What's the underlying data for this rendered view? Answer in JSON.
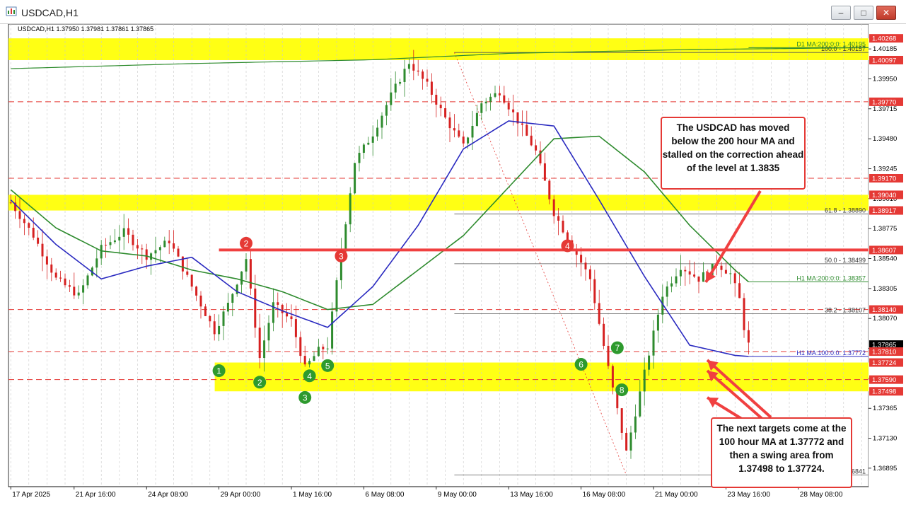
{
  "window": {
    "title": "USDCAD,H1",
    "min_glyph": "–",
    "max_glyph": "□",
    "close_glyph": "✕",
    "app_icon": "chart-window-icon"
  },
  "info_line": "USDCAD,H1  1.37950 1.37981 1.37861 1.37865",
  "callouts": [
    "The USDCAD has moved below the 200 hour MA and stalled on the correction ahead of the level at 1.3835",
    "The next targets come at the 100 hour MA at 1.37772 and then a swing area from 1.37498 to 1.37724."
  ],
  "chart_data": {
    "type": "candlestick",
    "symbol": "USDCAD",
    "timeframe": "H1",
    "ylim": [
      1.3675,
      1.4038
    ],
    "price_axis_ticks": [
      "1.40185",
      "1.39950",
      "1.39715",
      "1.39480",
      "1.39245",
      "1.39010",
      "1.38775",
      "1.38540",
      "1.38305",
      "1.38070",
      "1.37835",
      "1.37600",
      "1.37365",
      "1.37130",
      "1.36895"
    ],
    "price_ticks_values": [
      1.40185,
      1.3995,
      1.39715,
      1.3948,
      1.39245,
      1.3901,
      1.38775,
      1.3854,
      1.38305,
      1.3807,
      1.37835,
      1.376,
      1.37365,
      1.3713,
      1.36895
    ],
    "time_labels": [
      "17 Apr 2025",
      "21 Apr 16:00",
      "24 Apr 08:00",
      "29 Apr 00:00",
      "1 May 16:00",
      "6 May 08:00",
      "9 May 00:00",
      "13 May 16:00",
      "16 May 08:00",
      "21 May 00:00",
      "23 May 16:00",
      "28 May 08:00"
    ],
    "time_label_index": [
      0,
      14,
      30,
      46,
      62,
      78,
      94,
      110,
      126,
      142,
      158,
      174
    ],
    "num_bars": 190,
    "price_labels": [
      {
        "text": "1.40268",
        "value": 1.40268,
        "color": "#e53935"
      },
      {
        "text": "1.40097",
        "value": 1.40097,
        "color": "#e53935"
      },
      {
        "text": "1.39770",
        "value": 1.3977,
        "color": "#e53935"
      },
      {
        "text": "1.39170",
        "value": 1.3917,
        "color": "#e53935"
      },
      {
        "text": "1.39040",
        "value": 1.3904,
        "color": "#e53935"
      },
      {
        "text": "1.38917",
        "value": 1.38917,
        "color": "#e53935"
      },
      {
        "text": "1.38607",
        "value": 1.38607,
        "color": "#e53935"
      },
      {
        "text": "1.38140",
        "value": 1.3814,
        "color": "#e53935"
      },
      {
        "text": "1.37865",
        "value": 1.37865,
        "color": "#000000"
      },
      {
        "text": "1.37810",
        "value": 1.3781,
        "color": "#e53935"
      },
      {
        "text": "1.37724",
        "value": 1.37724,
        "color": "#e53935"
      },
      {
        "text": "1.37590",
        "value": 1.3759,
        "color": "#e53935"
      },
      {
        "text": "1.37498",
        "value": 1.37498,
        "color": "#e53935"
      }
    ],
    "yellow_zones": [
      {
        "from": 1.40097,
        "to": 1.40268
      },
      {
        "from": 1.38917,
        "to": 1.3904
      },
      {
        "from": 1.37498,
        "to": 1.37724
      }
    ],
    "dashed_levels": [
      1.3977,
      1.3917,
      1.3814,
      1.3781,
      1.3759
    ],
    "fib_levels": [
      {
        "label": "100.0 - 1.40157",
        "value": 1.40157
      },
      {
        "label": "61.8 - 1.38890",
        "value": 1.3889
      },
      {
        "label": "50.0 - 1.38499",
        "value": 1.38499
      },
      {
        "label": "38.2 - 1.38107",
        "value": 1.38107
      },
      {
        "label": "6841",
        "value": 1.36841
      }
    ],
    "ma_labels": [
      {
        "label": "D1 MA:200:0:0: 1.40195",
        "value": 1.40195,
        "color": "#2e8b2e"
      },
      {
        "label": "H1 MA:200:0:0: 1.38357",
        "value": 1.38357,
        "color": "#2e8b2e"
      },
      {
        "label": "H1 MA:100:0:0: 1.37772",
        "value": 1.37772,
        "color": "#2a2ac0"
      }
    ],
    "resistance_line": {
      "value": 1.38607,
      "from_index": 46
    },
    "markers": [
      {
        "label": "1",
        "index": 46,
        "value": 1.3766,
        "color": "#2e9a2e"
      },
      {
        "label": "2",
        "index": 55,
        "value": 1.3757,
        "color": "#2e9a2e"
      },
      {
        "label": "3",
        "index": 65,
        "value": 1.3745,
        "color": "#2e9a2e"
      },
      {
        "label": "4",
        "index": 66,
        "value": 1.3762,
        "color": "#2e9a2e"
      },
      {
        "label": "5",
        "index": 70,
        "value": 1.377,
        "color": "#2e9a2e"
      },
      {
        "label": "6",
        "index": 126,
        "value": 1.3771,
        "color": "#2e9a2e"
      },
      {
        "label": "7",
        "index": 134,
        "value": 1.3784,
        "color": "#2e9a2e"
      },
      {
        "label": "8",
        "index": 135,
        "value": 1.3751,
        "color": "#2e9a2e"
      },
      {
        "label": "2",
        "index": 52,
        "value": 1.3866,
        "color": "#e53935"
      },
      {
        "label": "3",
        "index": 73,
        "value": 1.3856,
        "color": "#e53935"
      },
      {
        "label": "4",
        "index": 123,
        "value": 1.3864,
        "color": "#e53935"
      }
    ],
    "close_path": [
      [
        0,
        1.3898
      ],
      [
        5,
        1.3872
      ],
      [
        10,
        1.3838
      ],
      [
        15,
        1.3825
      ],
      [
        20,
        1.3862
      ],
      [
        25,
        1.3875
      ],
      [
        30,
        1.3856
      ],
      [
        35,
        1.3868
      ],
      [
        40,
        1.3832
      ],
      [
        45,
        1.3797
      ],
      [
        48,
        1.3818
      ],
      [
        52,
        1.3854
      ],
      [
        55,
        1.3776
      ],
      [
        58,
        1.3818
      ],
      [
        62,
        1.3805
      ],
      [
        65,
        1.3768
      ],
      [
        68,
        1.3782
      ],
      [
        70,
        1.3785
      ],
      [
        73,
        1.386
      ],
      [
        76,
        1.393
      ],
      [
        80,
        1.3952
      ],
      [
        84,
        1.3982
      ],
      [
        88,
        1.4008
      ],
      [
        92,
        1.399
      ],
      [
        96,
        1.3964
      ],
      [
        100,
        1.3942
      ],
      [
        104,
        1.3976
      ],
      [
        108,
        1.3985
      ],
      [
        112,
        1.3962
      ],
      [
        116,
        1.3938
      ],
      [
        120,
        1.389
      ],
      [
        124,
        1.3864
      ],
      [
        128,
        1.3838
      ],
      [
        132,
        1.3768
      ],
      [
        136,
        1.3702
      ],
      [
        140,
        1.3764
      ],
      [
        144,
        1.3826
      ],
      [
        148,
        1.3848
      ],
      [
        152,
        1.3838
      ],
      [
        156,
        1.385
      ],
      [
        159,
        1.3842
      ],
      [
        161,
        1.3822
      ],
      [
        162,
        1.38
      ],
      [
        163,
        1.37865
      ]
    ],
    "ma200_h1": [
      [
        0,
        1.3908
      ],
      [
        10,
        1.3878
      ],
      [
        20,
        1.386
      ],
      [
        30,
        1.3856
      ],
      [
        40,
        1.3845
      ],
      [
        50,
        1.3838
      ],
      [
        60,
        1.3828
      ],
      [
        70,
        1.3814
      ],
      [
        80,
        1.3818
      ],
      [
        90,
        1.3845
      ],
      [
        100,
        1.3872
      ],
      [
        110,
        1.391
      ],
      [
        120,
        1.3948
      ],
      [
        130,
        1.395
      ],
      [
        140,
        1.3922
      ],
      [
        150,
        1.388
      ],
      [
        160,
        1.3845
      ],
      [
        163,
        1.38357
      ]
    ],
    "ma100_h1": [
      [
        0,
        1.39
      ],
      [
        10,
        1.3865
      ],
      [
        20,
        1.3838
      ],
      [
        30,
        1.3848
      ],
      [
        40,
        1.3855
      ],
      [
        50,
        1.3828
      ],
      [
        60,
        1.3813
      ],
      [
        70,
        1.38
      ],
      [
        80,
        1.3832
      ],
      [
        90,
        1.388
      ],
      [
        100,
        1.394
      ],
      [
        110,
        1.3962
      ],
      [
        120,
        1.3958
      ],
      [
        130,
        1.39
      ],
      [
        140,
        1.384
      ],
      [
        150,
        1.3786
      ],
      [
        160,
        1.3778
      ],
      [
        163,
        1.37772
      ]
    ],
    "ma200_d1": [
      [
        0,
        1.4003
      ],
      [
        40,
        1.4007
      ],
      [
        80,
        1.401
      ],
      [
        110,
        1.4015
      ],
      [
        150,
        1.4018
      ],
      [
        190,
        1.40195
      ]
    ],
    "resistance_label": "1.38607"
  }
}
